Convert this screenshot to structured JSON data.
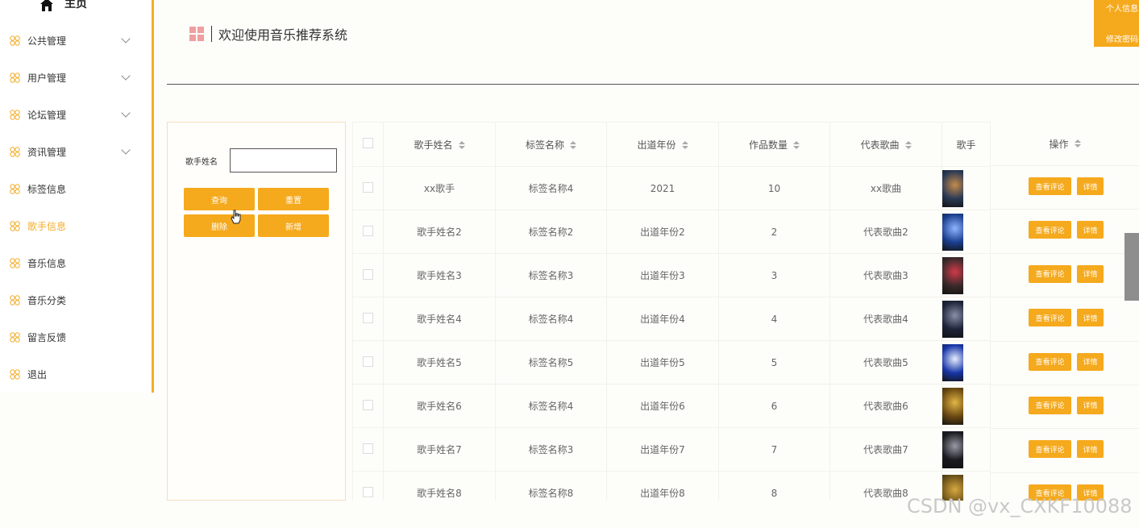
{
  "sidebar": {
    "home_label": "主页",
    "items": [
      {
        "label": "公共管理",
        "expandable": true
      },
      {
        "label": "用户管理",
        "expandable": true
      },
      {
        "label": "论坛管理",
        "expandable": true
      },
      {
        "label": "资讯管理",
        "expandable": true
      },
      {
        "label": "标签信息",
        "expandable": false
      },
      {
        "label": "歌手信息",
        "expandable": false,
        "active": true
      },
      {
        "label": "音乐信息",
        "expandable": false
      },
      {
        "label": "音乐分类",
        "expandable": false
      },
      {
        "label": "留言反馈",
        "expandable": false
      },
      {
        "label": "退出",
        "expandable": false
      }
    ]
  },
  "header": {
    "title": "欢迎使用音乐推荐系统",
    "user_menu": {
      "profile": "个人信息",
      "change_password": "修改密码"
    }
  },
  "search": {
    "field_label": "歌手姓名",
    "field_value": "",
    "buttons": {
      "query": "查询",
      "reset": "重置",
      "delete": "删除",
      "add": "新增"
    }
  },
  "table": {
    "columns": [
      "歌手姓名",
      "标签名称",
      "出道年份",
      "作品数量",
      "代表歌曲",
      "歌手",
      "操作"
    ],
    "rows": [
      {
        "name": "xx歌手",
        "tag": "标签名称4",
        "year": "2021",
        "count": "10",
        "song": "xx歌曲"
      },
      {
        "name": "歌手姓名2",
        "tag": "标签名称2",
        "year": "出道年份2",
        "count": "2",
        "song": "代表歌曲2"
      },
      {
        "name": "歌手姓名3",
        "tag": "标签名称3",
        "year": "出道年份3",
        "count": "3",
        "song": "代表歌曲3"
      },
      {
        "name": "歌手姓名4",
        "tag": "标签名称4",
        "year": "出道年份4",
        "count": "4",
        "song": "代表歌曲4"
      },
      {
        "name": "歌手姓名5",
        "tag": "标签名称5",
        "year": "出道年份5",
        "count": "5",
        "song": "代表歌曲5"
      },
      {
        "name": "歌手姓名6",
        "tag": "标签名称4",
        "year": "出道年份6",
        "count": "6",
        "song": "代表歌曲6"
      },
      {
        "name": "歌手姓名7",
        "tag": "标签名称3",
        "year": "出道年份7",
        "count": "7",
        "song": "代表歌曲7"
      },
      {
        "name": "歌手姓名8",
        "tag": "标签名称8",
        "year": "出道年份8",
        "count": "8",
        "song": "代表歌曲8"
      }
    ],
    "row_actions": {
      "comments": "查看评论",
      "detail": "详情"
    }
  },
  "watermark": "CSDN @vx_CXKF10088",
  "colors": {
    "accent": "#f5a91c",
    "active_text": "#f3ad2a",
    "title_icon": "#ef9f9f"
  }
}
